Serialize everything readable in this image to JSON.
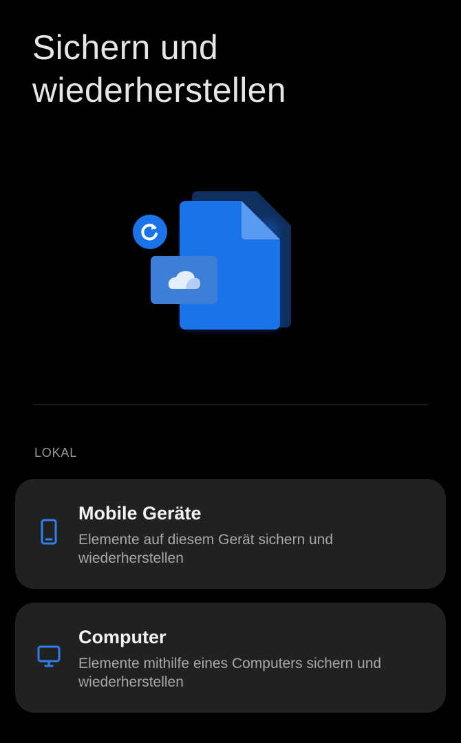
{
  "header": {
    "title": "Sichern und wiederherstellen"
  },
  "illustration": {
    "icon": "backup-documents-cloud-illustration",
    "accent_color": "#1a73e8"
  },
  "sections": {
    "local": {
      "header": "LOKAL",
      "items": [
        {
          "title": "Mobile Geräte",
          "description": "Elemente auf diesem Gerät sichern und wiederherstellen",
          "icon": "smartphone-icon"
        },
        {
          "title": "Computer",
          "description": "Elemente mithilfe eines Computers sichern und wiederherstellen",
          "icon": "computer-monitor-icon"
        }
      ]
    }
  },
  "colors": {
    "background": "#000000",
    "card": "#212121",
    "accent": "#1a73e8",
    "title_text": "#f2f2f2",
    "secondary_text": "#a8a8a8"
  }
}
